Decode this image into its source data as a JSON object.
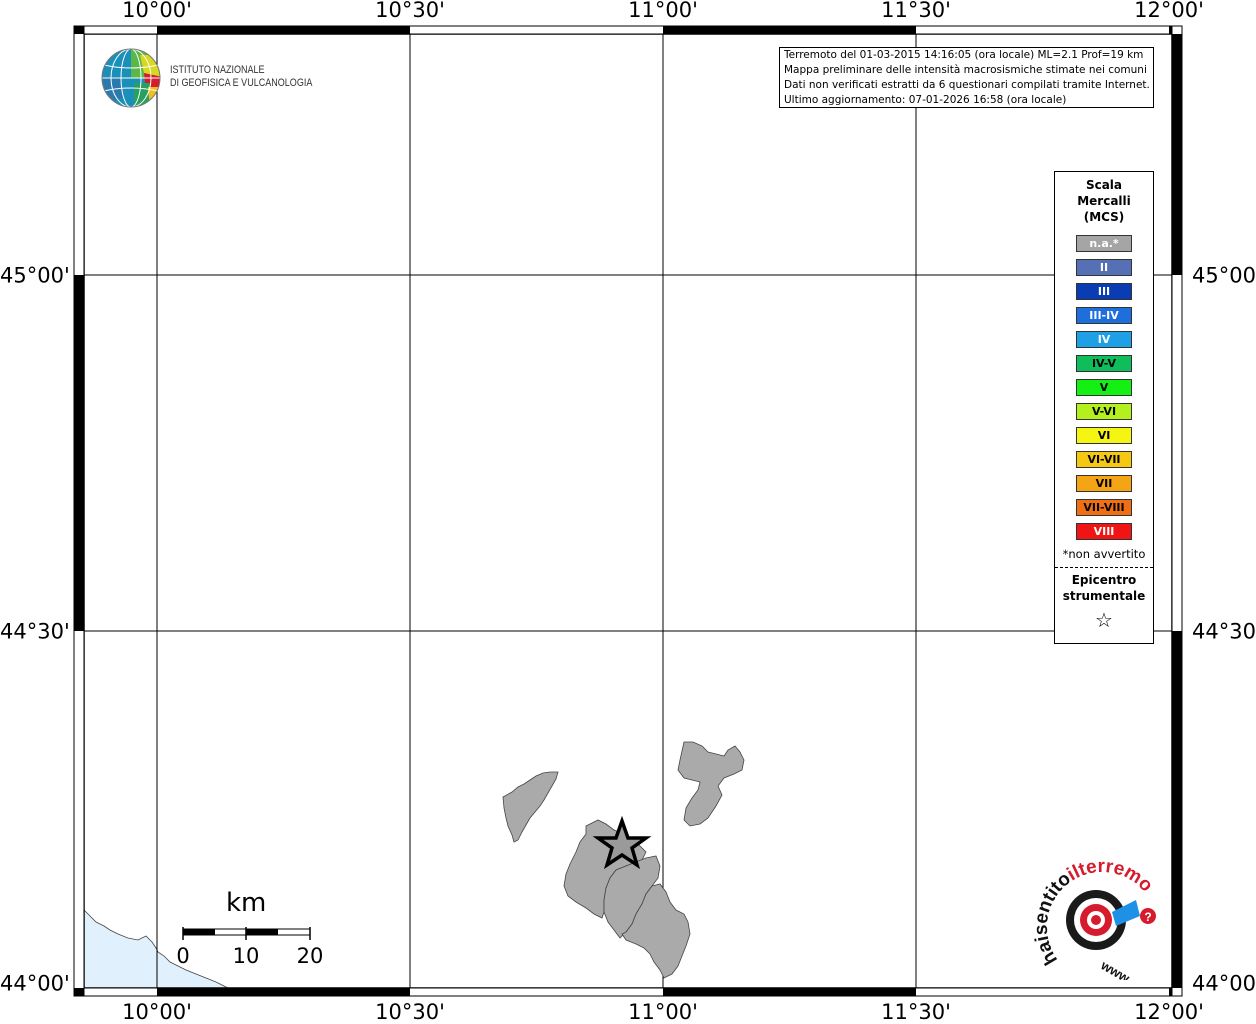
{
  "map": {
    "lon_labels": [
      "10°00'",
      "10°30'",
      "11°00'",
      "11°30'",
      "12°00'"
    ],
    "lat_labels": [
      "45°00'",
      "44°30'",
      "44°00'"
    ],
    "colors": {
      "land_fill": "#aaaaaa",
      "sea_fill": "#e0f0fc",
      "frame": "#000000"
    }
  },
  "logo": {
    "line1": "ISTITUTO NAZIONALE",
    "line2": "DI GEOFISICA E VULCANOLOGIA"
  },
  "info": {
    "line1": "Terremoto del 01-03-2015 14:16:05 (ora locale) ML=2.1 Prof=19 km",
    "line2": "Mappa preliminare delle intensità macrosismiche stimate nei comuni",
    "line3": "Dati non verificati estratti da 6 questionari compilati tramite Internet.",
    "line4": "Ultimo aggiornamento: 07-01-2026 16:58 (ora locale)"
  },
  "legend": {
    "title1": "Scala",
    "title2": "Mercalli",
    "title3": "(MCS)",
    "classes": [
      {
        "label": "n.a.*",
        "color": "#a5a5a5",
        "text_color": "#ffffff"
      },
      {
        "label": "II",
        "color": "#5570b4",
        "text_color": "#ffffff"
      },
      {
        "label": "III",
        "color": "#0a3cb4",
        "text_color": "#ffffff"
      },
      {
        "label": "III-IV",
        "color": "#1e6fdc",
        "text_color": "#ffffff"
      },
      {
        "label": "IV",
        "color": "#1ea0e6",
        "text_color": "#ffffff"
      },
      {
        "label": "IV-V",
        "color": "#0fbe5a",
        "text_color": "#000000"
      },
      {
        "label": "V",
        "color": "#14f014",
        "text_color": "#000000"
      },
      {
        "label": "V-VI",
        "color": "#b4f01e",
        "text_color": "#000000"
      },
      {
        "label": "VI",
        "color": "#f5f514",
        "text_color": "#000000"
      },
      {
        "label": "VI-VII",
        "color": "#f5c814",
        "text_color": "#000000"
      },
      {
        "label": "VII",
        "color": "#f5a514",
        "text_color": "#000000"
      },
      {
        "label": "VII-VIII",
        "color": "#f06e14",
        "text_color": "#000000"
      },
      {
        "label": "VIII",
        "color": "#f01414",
        "text_color": "#ffffff"
      }
    ],
    "note": "*non avvertito",
    "epicenter_title1": "Epicentro",
    "epicenter_title2": "strumentale",
    "epicenter_symbol": "☆"
  },
  "scalebar": {
    "unit": "km",
    "ticks": [
      "0",
      "10",
      "20"
    ]
  },
  "hsit_logo": {
    "text1": "haisentito",
    "text2": "ilterremoto.it",
    "text3": "www.",
    "icons": [
      "target-icon",
      "speaker-icon",
      "question-mark-icon"
    ]
  }
}
